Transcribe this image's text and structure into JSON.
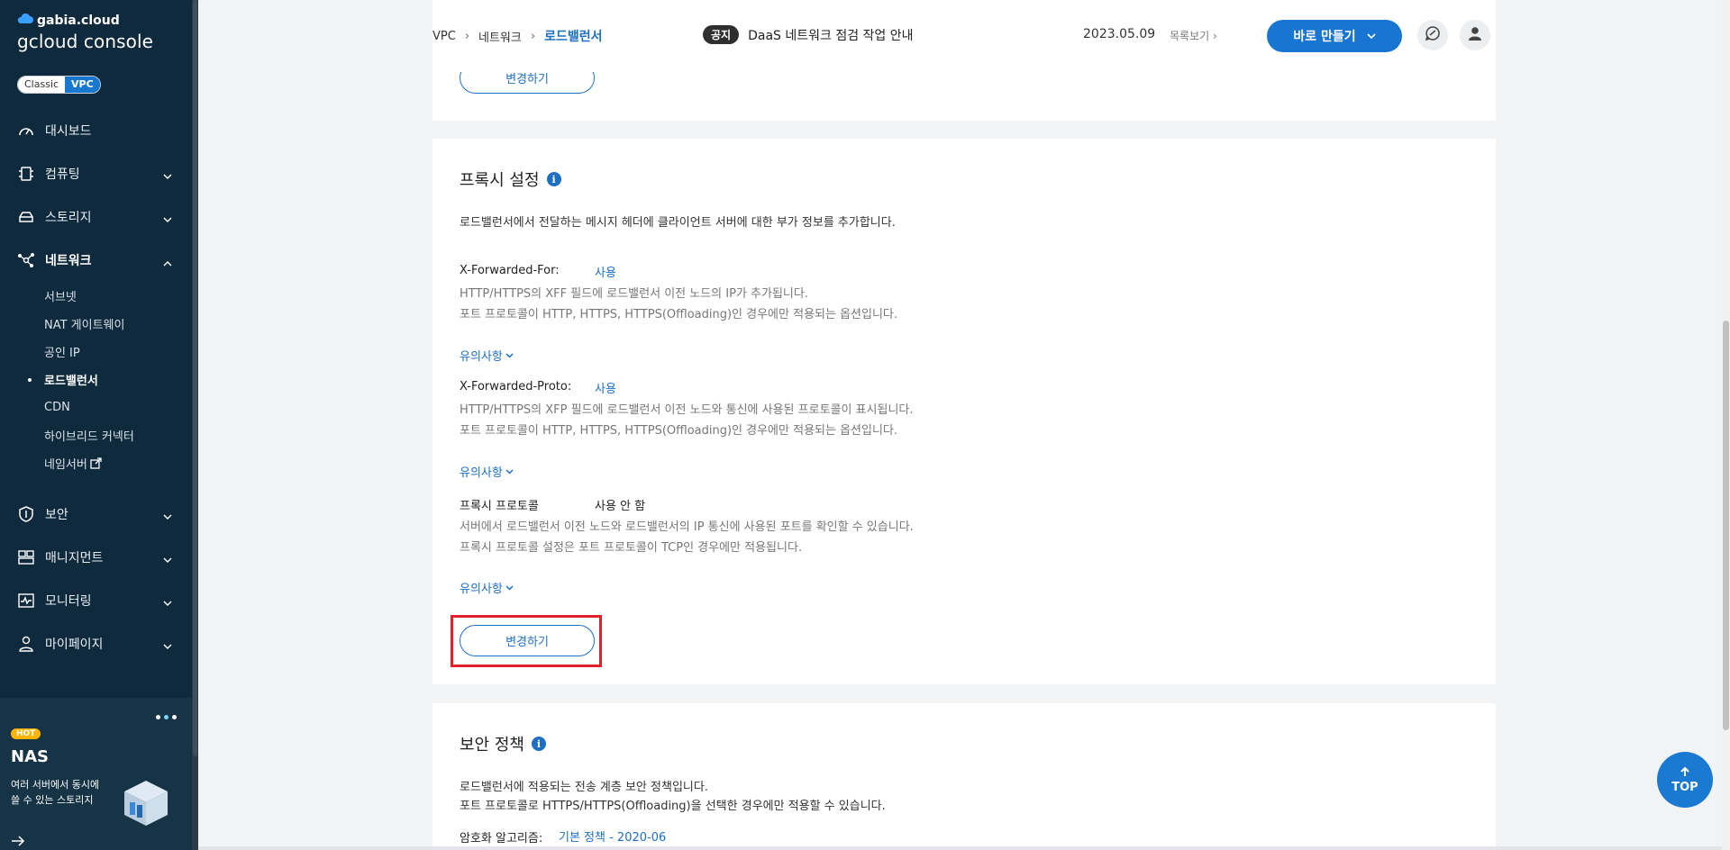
{
  "sidebar": {
    "brand": "gabia.cloud",
    "console": "gcloud console",
    "toggle": {
      "classic": "Classic",
      "vpc": "VPC"
    },
    "items": [
      {
        "label": "대시보드",
        "icon": "gauge-icon",
        "expandable": false
      },
      {
        "label": "컴퓨팅",
        "icon": "chip-icon",
        "expandable": true
      },
      {
        "label": "스토리지",
        "icon": "storage-icon",
        "expandable": true
      },
      {
        "label": "네트워크",
        "icon": "network-icon",
        "expandable": true,
        "open": true
      }
    ],
    "network_sub": [
      "서브넷",
      "NAT 게이트웨이",
      "공인 IP",
      "로드밸런서",
      "CDN",
      "하이브리드 커넥터",
      "네임서버"
    ],
    "items_after": [
      {
        "label": "보안",
        "icon": "shield-icon"
      },
      {
        "label": "매니지먼트",
        "icon": "management-icon"
      },
      {
        "label": "모니터링",
        "icon": "monitoring-icon"
      },
      {
        "label": "마이페이지",
        "icon": "user-icon"
      }
    ],
    "promo": {
      "hot": "HOT",
      "title": "NAS",
      "line1": "여러 서버에서 동시에",
      "line2": "쓸 수 있는 스토리지"
    }
  },
  "header": {
    "breadcrumb": [
      "VPC",
      "네트워크",
      "로드밸런서"
    ],
    "notice_tag": "공지",
    "notice_text": "DaaS 네트워크 점검 작업 안내",
    "date": "2023.05.09",
    "list_link": "목록보기",
    "create_button": "바로 만들기"
  },
  "card1": {
    "change_button": "변경하기"
  },
  "proxy": {
    "title": "프록시 설정",
    "intro": "로드밸런서에서 전달하는 메시지 헤더에 클라이언트 서버에 대한 부가 정보를 추가합니다.",
    "xff": {
      "label": "X-Forwarded-For:",
      "value": "사용",
      "desc1": "HTTP/HTTPS의 XFF 필드에 로드밸런서 이전 노드의 IP가 추가됩니다.",
      "desc2": "포트 프로토콜이 HTTP, HTTPS, HTTPS(Offloading)인 경우에만 적용되는 옵션입니다.",
      "note": "유의사항"
    },
    "xfp": {
      "label": "X-Forwarded-Proto:",
      "value": "사용",
      "desc1": "HTTP/HTTPS의 XFP 필드에 로드밸런서 이전 노드와 통신에 사용된 프로토콜이 표시됩니다.",
      "desc2": "포트 프로토콜이 HTTP, HTTPS, HTTPS(Offloading)인 경우에만 적용되는 옵션입니다.",
      "note": "유의사항"
    },
    "proxy_protocol": {
      "label": "프록시 프로토콜",
      "value": "사용 안 함",
      "desc1": "서버에서 로드밸런서 이전 노드와 로드밸런서의 IP 통신에 사용된 포트를 확인할 수 있습니다.",
      "desc2": "프록시 프로토콜 설정은 포트 프로토콜이 TCP인 경우에만 적용됩니다.",
      "note": "유의사항"
    },
    "change_button": "변경하기"
  },
  "security": {
    "title": "보안 정책",
    "desc1": "로드밸런서에 적용되는 전송 계층 보안 정책입니다.",
    "desc2": "포트 프로토콜로 HTTPS/HTTPS(Offloading)을 선택한 경우에만 적용할 수 있습니다.",
    "algo_label": "암호화 알고리즘:",
    "algo_value": "기본 정책 - 2020-06"
  },
  "top_button": "TOP",
  "colors": {
    "sidebar": "#0f2a3d",
    "accent": "#1d6fc4",
    "highlight": "#e0222c"
  }
}
